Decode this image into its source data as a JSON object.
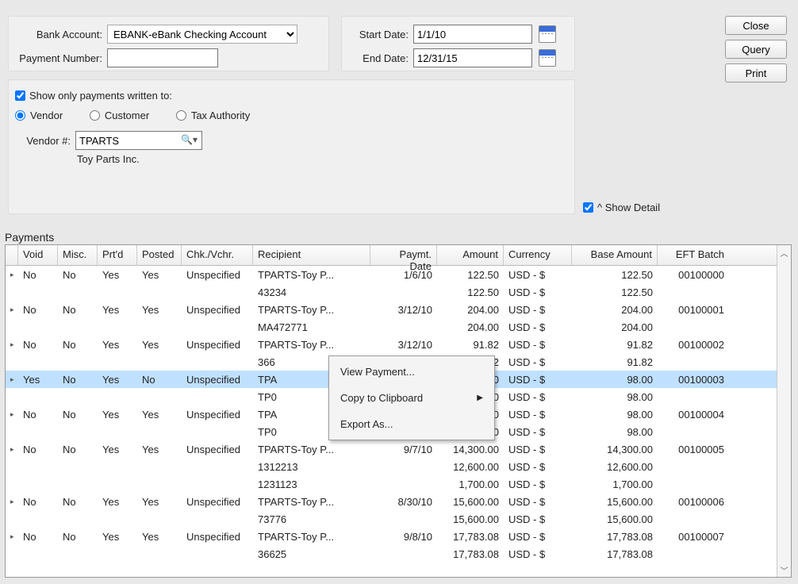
{
  "header": {
    "bankAccountLabel": "Bank Account:",
    "bankAccountValue": "EBANK-eBank Checking Account",
    "paymentNumberLabel": "Payment Number:",
    "paymentNumberValue": "",
    "startDateLabel": "Start Date:",
    "startDateValue": "1/1/10",
    "endDateLabel": "End Date:",
    "endDateValue": "12/31/15"
  },
  "buttons": {
    "close": "Close",
    "query": "Query",
    "print": "Print"
  },
  "filter": {
    "showOnlyLabel": "Show only payments written to:",
    "showOnlyChecked": true,
    "radio": {
      "vendor": "Vendor",
      "customer": "Customer",
      "tax": "Tax Authority",
      "selected": "vendor"
    },
    "vendorNumLabel": "Vendor #:",
    "vendorNumValue": "TPARTS",
    "vendorName": "Toy Parts Inc."
  },
  "showDetailLabel": "^ Show Detail",
  "showDetailChecked": true,
  "paymentsLabel": "Payments",
  "columns": {
    "void": "Void",
    "misc": "Misc.",
    "prtd": "Prt'd",
    "posted": "Posted",
    "chk": "Chk./Vchr.",
    "recipient": "Recipient",
    "paymtDate": "Paymt. Date",
    "amount": "Amount",
    "currency": "Currency",
    "baseAmount": "Base Amount",
    "eft": "EFT Batch"
  },
  "rows": [
    {
      "exp": "▸",
      "void": "No",
      "misc": "No",
      "prtd": "Yes",
      "posted": "Yes",
      "chk": "Unspecified",
      "rec": "TPARTS-Toy P...",
      "date": "1/6/10",
      "amt": "122.50",
      "cur": "USD - $",
      "base": "122.50",
      "eft": "00100000"
    },
    {
      "exp": "",
      "void": "",
      "misc": "",
      "prtd": "",
      "posted": "",
      "chk": "",
      "rec": "43234",
      "date": "",
      "amt": "122.50",
      "cur": "USD - $",
      "base": "122.50",
      "eft": ""
    },
    {
      "exp": "▸",
      "void": "No",
      "misc": "No",
      "prtd": "Yes",
      "posted": "Yes",
      "chk": "Unspecified",
      "rec": "TPARTS-Toy P...",
      "date": "3/12/10",
      "amt": "204.00",
      "cur": "USD - $",
      "base": "204.00",
      "eft": "00100001"
    },
    {
      "exp": "",
      "void": "",
      "misc": "",
      "prtd": "",
      "posted": "",
      "chk": "",
      "rec": "MA472771",
      "date": "",
      "amt": "204.00",
      "cur": "USD - $",
      "base": "204.00",
      "eft": ""
    },
    {
      "exp": "▸",
      "void": "No",
      "misc": "No",
      "prtd": "Yes",
      "posted": "Yes",
      "chk": "Unspecified",
      "rec": "TPARTS-Toy P...",
      "date": "3/12/10",
      "amt": "91.82",
      "cur": "USD - $",
      "base": "91.82",
      "eft": "00100002"
    },
    {
      "exp": "",
      "void": "",
      "misc": "",
      "prtd": "",
      "posted": "",
      "chk": "",
      "rec": "366",
      "date": "",
      "amt": "91.82",
      "cur": "USD - $",
      "base": "91.82",
      "eft": ""
    },
    {
      "exp": "▸",
      "void": "Yes",
      "misc": "No",
      "prtd": "Yes",
      "posted": "No",
      "chk": "Unspecified",
      "rec": "TPA",
      "date": "",
      "amt": "98.00",
      "cur": "USD - $",
      "base": "98.00",
      "eft": "00100003",
      "sel": true
    },
    {
      "exp": "",
      "void": "",
      "misc": "",
      "prtd": "",
      "posted": "",
      "chk": "",
      "rec": "TP0",
      "date": "",
      "amt": "98.00",
      "cur": "USD - $",
      "base": "98.00",
      "eft": ""
    },
    {
      "exp": "▸",
      "void": "No",
      "misc": "No",
      "prtd": "Yes",
      "posted": "Yes",
      "chk": "Unspecified",
      "rec": "TPA",
      "date": "",
      "amt": "98.00",
      "cur": "USD - $",
      "base": "98.00",
      "eft": "00100004"
    },
    {
      "exp": "",
      "void": "",
      "misc": "",
      "prtd": "",
      "posted": "",
      "chk": "",
      "rec": "TP0",
      "date": "",
      "amt": "98.00",
      "cur": "USD - $",
      "base": "98.00",
      "eft": ""
    },
    {
      "exp": "▸",
      "void": "No",
      "misc": "No",
      "prtd": "Yes",
      "posted": "Yes",
      "chk": "Unspecified",
      "rec": "TPARTS-Toy P...",
      "date": "9/7/10",
      "amt": "14,300.00",
      "cur": "USD - $",
      "base": "14,300.00",
      "eft": "00100005"
    },
    {
      "exp": "",
      "void": "",
      "misc": "",
      "prtd": "",
      "posted": "",
      "chk": "",
      "rec": "1312213",
      "date": "",
      "amt": "12,600.00",
      "cur": "USD - $",
      "base": "12,600.00",
      "eft": ""
    },
    {
      "exp": "",
      "void": "",
      "misc": "",
      "prtd": "",
      "posted": "",
      "chk": "",
      "rec": "1231123",
      "date": "",
      "amt": "1,700.00",
      "cur": "USD - $",
      "base": "1,700.00",
      "eft": ""
    },
    {
      "exp": "▸",
      "void": "No",
      "misc": "No",
      "prtd": "Yes",
      "posted": "Yes",
      "chk": "Unspecified",
      "rec": "TPARTS-Toy P...",
      "date": "8/30/10",
      "amt": "15,600.00",
      "cur": "USD - $",
      "base": "15,600.00",
      "eft": "00100006"
    },
    {
      "exp": "",
      "void": "",
      "misc": "",
      "prtd": "",
      "posted": "",
      "chk": "",
      "rec": "73776",
      "date": "",
      "amt": "15,600.00",
      "cur": "USD - $",
      "base": "15,600.00",
      "eft": ""
    },
    {
      "exp": "▸",
      "void": "No",
      "misc": "No",
      "prtd": "Yes",
      "posted": "Yes",
      "chk": "Unspecified",
      "rec": "TPARTS-Toy P...",
      "date": "9/8/10",
      "amt": "17,783.08",
      "cur": "USD - $",
      "base": "17,783.08",
      "eft": "00100007"
    },
    {
      "exp": "",
      "void": "",
      "misc": "",
      "prtd": "",
      "posted": "",
      "chk": "",
      "rec": "36625",
      "date": "",
      "amt": "17,783.08",
      "cur": "USD - $",
      "base": "17,783.08",
      "eft": ""
    }
  ],
  "contextMenu": {
    "viewPayment": "View Payment...",
    "copy": "Copy to Clipboard",
    "export": "Export As..."
  }
}
